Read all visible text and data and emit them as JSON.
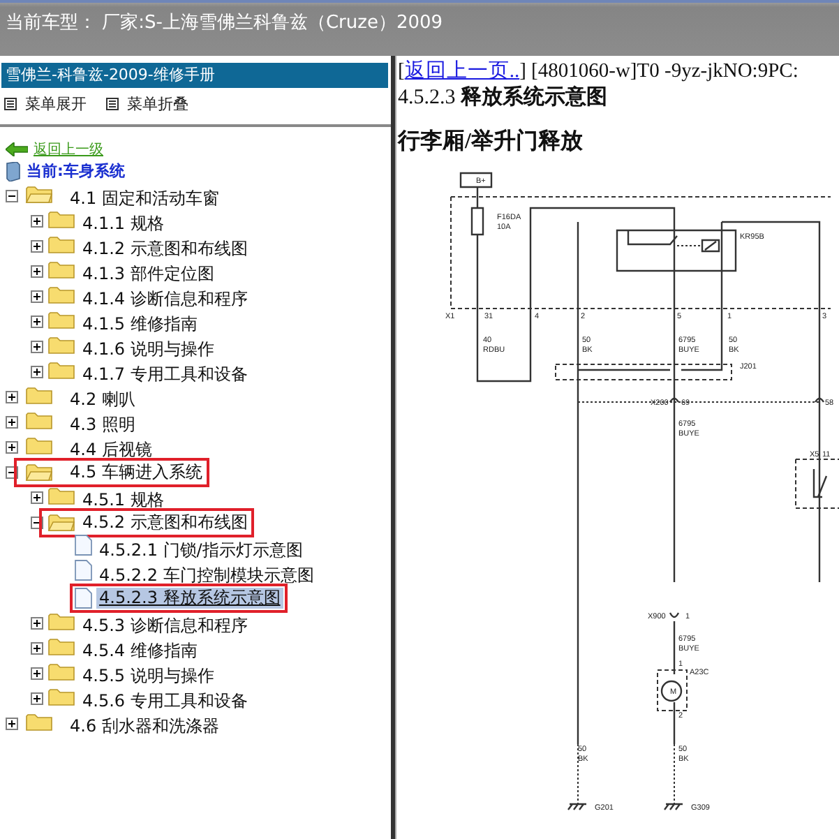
{
  "title_bar": {
    "text": "当前车型： 厂家:S-上海雪佛兰科鲁兹（Cruze）2009"
  },
  "nav": {
    "header": "雪佛兰-科鲁兹-2009-维修手册",
    "menu": [
      "菜单展开",
      "菜单折叠"
    ],
    "back_link": "返回上一级",
    "current": "当前:车身系统",
    "tree": [
      {
        "label": "4.1 固定和活动车窗",
        "kind": "folder",
        "expanded": true,
        "selected": false,
        "outlined": false,
        "children": [
          {
            "label": "4.1.1 规格",
            "kind": "folder",
            "expanded": false,
            "selected": false,
            "outlined": false
          },
          {
            "label": "4.1.2 示意图和布线图",
            "kind": "folder",
            "expanded": false,
            "selected": false,
            "outlined": false
          },
          {
            "label": "4.1.3 部件定位图",
            "kind": "folder",
            "expanded": false,
            "selected": false,
            "outlined": false
          },
          {
            "label": "4.1.4 诊断信息和程序",
            "kind": "folder",
            "expanded": false,
            "selected": false,
            "outlined": false
          },
          {
            "label": "4.1.5 维修指南",
            "kind": "folder",
            "expanded": false,
            "selected": false,
            "outlined": false
          },
          {
            "label": "4.1.6 说明与操作",
            "kind": "folder",
            "expanded": false,
            "selected": false,
            "outlined": false
          },
          {
            "label": "4.1.7 专用工具和设备",
            "kind": "folder",
            "expanded": false,
            "selected": false,
            "outlined": false
          }
        ]
      },
      {
        "label": "4.2 喇叭",
        "kind": "folder",
        "expanded": false,
        "selected": false,
        "outlined": false
      },
      {
        "label": "4.3 照明",
        "kind": "folder",
        "expanded": false,
        "selected": false,
        "outlined": false
      },
      {
        "label": "4.4 后视镜",
        "kind": "folder",
        "expanded": false,
        "selected": false,
        "outlined": false
      },
      {
        "label": "4.5 车辆进入系统",
        "kind": "folder",
        "expanded": true,
        "selected": false,
        "outlined": true,
        "children": [
          {
            "label": "4.5.1 规格",
            "kind": "folder",
            "expanded": false,
            "selected": false,
            "outlined": false
          },
          {
            "label": "4.5.2 示意图和布线图",
            "kind": "folder",
            "expanded": true,
            "selected": false,
            "outlined": true,
            "children": [
              {
                "label": "4.5.2.1 门锁/指示灯示意图",
                "kind": "page",
                "selected": false,
                "outlined": false
              },
              {
                "label": "4.5.2.2 车门控制模块示意图",
                "kind": "page",
                "selected": false,
                "outlined": false
              },
              {
                "label": "4.5.2.3 释放系统示意图",
                "kind": "page",
                "selected": true,
                "outlined": true
              }
            ]
          },
          {
            "label": "4.5.3 诊断信息和程序",
            "kind": "folder",
            "expanded": false,
            "selected": false,
            "outlined": false
          },
          {
            "label": "4.5.4 维修指南",
            "kind": "folder",
            "expanded": false,
            "selected": false,
            "outlined": false
          },
          {
            "label": "4.5.5 说明与操作",
            "kind": "folder",
            "expanded": false,
            "selected": false,
            "outlined": false
          },
          {
            "label": "4.5.6 专用工具和设备",
            "kind": "folder",
            "expanded": false,
            "selected": false,
            "outlined": false
          }
        ]
      },
      {
        "label": "4.6 刮水器和洗涤器",
        "kind": "folder",
        "expanded": false,
        "selected": false,
        "outlined": false
      }
    ]
  },
  "document": {
    "link_before": "[",
    "link": "返回上一页..",
    "link_after": "] [4801060-w]T0 -9yz-jkNO:9PC:",
    "heading": "4.5.2.3 **释放系统示意图**",
    "subtitle": "行李厢/举升门释放",
    "diagram_labels": [
      "B+",
      "F16DA",
      "10A",
      "KR95B",
      "X1",
      "31",
      "4",
      "2",
      "5",
      "1",
      "3",
      "40",
      "RDBU",
      "50",
      "BK",
      "6795",
      "BUYE",
      "50",
      "BK",
      "J201",
      "X200",
      "69",
      "58",
      "6795",
      "BUYE",
      "X5",
      "11",
      "X900",
      "1",
      "6795",
      "BUYE",
      "1",
      "A23C",
      "M",
      "2",
      "50",
      "BK",
      "50",
      "BK",
      "G201",
      "G309"
    ]
  }
}
